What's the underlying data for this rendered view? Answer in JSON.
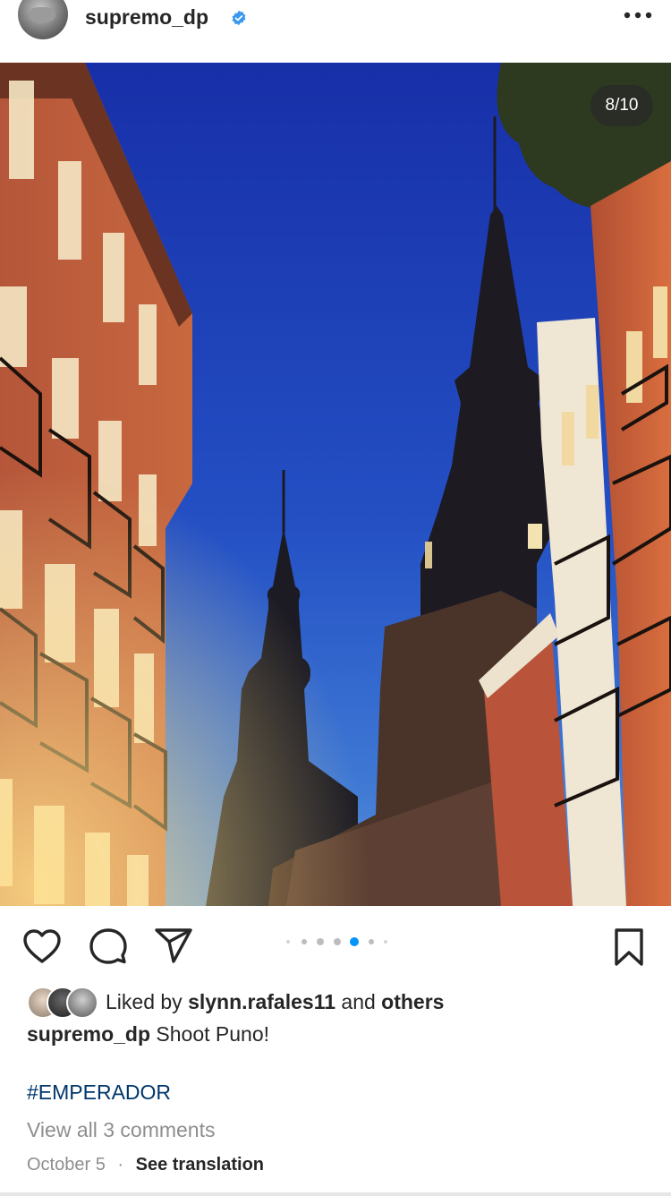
{
  "post": {
    "username": "supremo_dp",
    "verified": true,
    "more_icon": "more-horizontal-icon",
    "image_counter": "8/10",
    "carousel": {
      "total_dots": 7,
      "active_index": 4
    }
  },
  "actions": {
    "like_icon": "heart-outline-icon",
    "comment_icon": "comment-bubble-icon",
    "share_icon": "paper-plane-icon",
    "save_icon": "bookmark-outline-icon"
  },
  "likes": {
    "prefix": "Liked by",
    "user": "slynn.rafales11",
    "conjunction": "and",
    "others": "others"
  },
  "caption": {
    "username": "supremo_dp",
    "text": "Shoot Puno!"
  },
  "hashtag": "#EMPERADOR",
  "view_comments": "View all 3 comments",
  "date": "October 5",
  "separator": "·",
  "see_translation": "See translation",
  "colors": {
    "verified_blue": "#3897f0",
    "hashtag_blue": "#00376b",
    "active_dot": "#0095f6",
    "muted_text": "#8e8e8e"
  }
}
